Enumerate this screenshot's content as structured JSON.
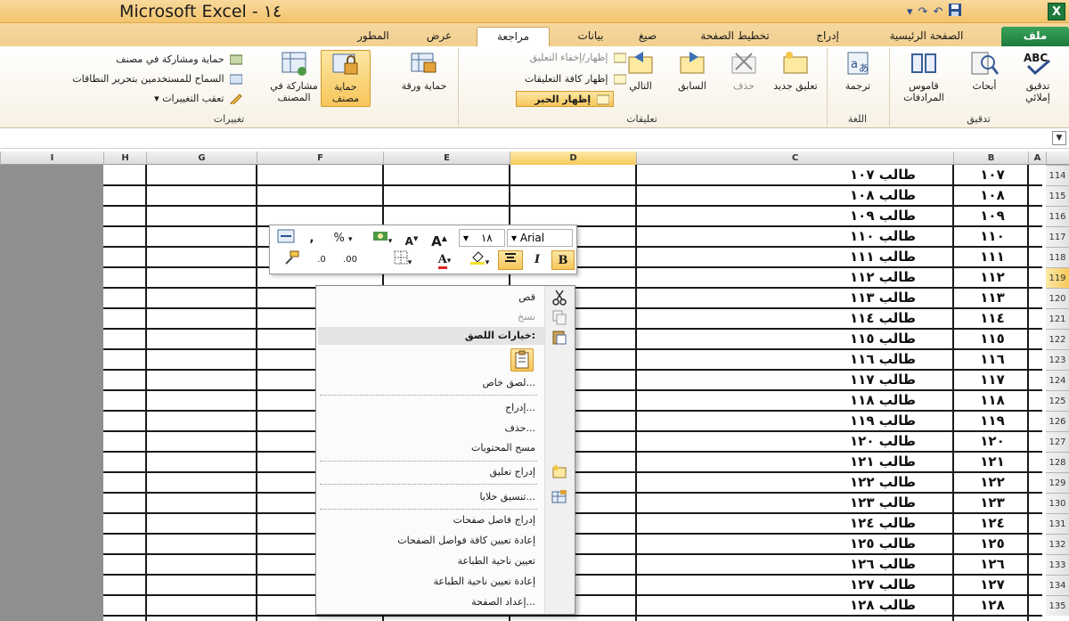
{
  "window": {
    "title": "Microsoft Excel - ١٤",
    "qat_icons": [
      "save-icon",
      "redo-icon",
      "undo-icon",
      "customize-icon"
    ]
  },
  "tabs": {
    "file": "ملف",
    "home": "الصفحة الرئيسية",
    "insert": "إدراج",
    "page_layout": "تخطيط الصفحة",
    "formulas": "صيغ",
    "data": "بيانات",
    "review": "مراجعة",
    "view": "عرض",
    "developer": "المطور"
  },
  "ribbon": {
    "proofing": {
      "label": "تدقيق",
      "spelling": "تدقيق إملائي",
      "research": "أبحاث",
      "thesaurus": "قاموس المرادفات"
    },
    "language": {
      "label": "اللغة",
      "translate": "ترجمة"
    },
    "comments": {
      "label": "تعليقات",
      "new_comment": "تعليق جديد",
      "delete": "حذف",
      "previous": "السابق",
      "next": "التالي",
      "show_hide": "إظهار/إخفاء التعليق",
      "show_all": "إظهار كافة التعليقات",
      "show_ink": "إظهار الحبر"
    },
    "changes": {
      "label": "تغييرات",
      "protect_sheet": "حماية ورقة",
      "protect_workbook": "حماية مصنف",
      "share_workbook": "مشاركة في المصنف",
      "protect_share": "حماية ومشاركة في مصنف",
      "allow_edit_ranges": "السماح للمستخدمين بتحرير النطاقات",
      "track_changes": "تعقب التغييرات"
    }
  },
  "columns": [
    "I",
    "H",
    "G",
    "F",
    "E",
    "D",
    "C",
    "B",
    "A"
  ],
  "selected_column": "D",
  "rows": [
    {
      "num": "114",
      "c": "طالب ١٠٧",
      "b": "١٠٧"
    },
    {
      "num": "115",
      "c": "طالب ١٠٨",
      "b": "١٠٨"
    },
    {
      "num": "116",
      "c": "طالب ١٠٩",
      "b": "١٠٩"
    },
    {
      "num": "117",
      "c": "طالب ١١٠",
      "b": "١١٠"
    },
    {
      "num": "118",
      "c": "طالب ١١١",
      "b": "١١١"
    },
    {
      "num": "119",
      "c": "طالب ١١٢",
      "b": "١١٢"
    },
    {
      "num": "120",
      "c": "طالب ١١٣",
      "b": "١١٣"
    },
    {
      "num": "121",
      "c": "طالب ١١٤",
      "b": "١١٤"
    },
    {
      "num": "122",
      "c": "طالب ١١٥",
      "b": "١١٥"
    },
    {
      "num": "123",
      "c": "طالب ١١٦",
      "b": "١١٦"
    },
    {
      "num": "124",
      "c": "طالب ١١٧",
      "b": "١١٧"
    },
    {
      "num": "125",
      "c": "طالب ١١٨",
      "b": "١١٨"
    },
    {
      "num": "126",
      "c": "طالب ١١٩",
      "b": "١١٩"
    },
    {
      "num": "127",
      "c": "طالب ١٢٠",
      "b": "١٢٠"
    },
    {
      "num": "128",
      "c": "طالب ١٢١",
      "b": "١٢١"
    },
    {
      "num": "129",
      "c": "طالب ١٢٢",
      "b": "١٢٢"
    },
    {
      "num": "130",
      "c": "طالب ١٢٣",
      "b": "١٢٣"
    },
    {
      "num": "131",
      "c": "طالب ١٢٤",
      "b": "١٢٤"
    },
    {
      "num": "132",
      "c": "طالب ١٢٥",
      "b": "١٢٥"
    },
    {
      "num": "133",
      "c": "طالب ١٢٦",
      "b": "١٢٦"
    },
    {
      "num": "134",
      "c": "طالب ١٢٧",
      "b": "١٢٧"
    },
    {
      "num": "135",
      "c": "طالب ١٢٨",
      "b": "١٢٨"
    }
  ],
  "selected_row": "119",
  "mini_toolbar": {
    "font_name": "Arial",
    "font_size": "١٨",
    "percent": "%",
    "comma": ","
  },
  "context_menu": {
    "cut": "قص",
    "copy": "نسخ",
    "paste_options": "خيارات اللصق:",
    "paste_special": "لصق خاص...",
    "insert": "إدراج...",
    "delete": "حذف...",
    "clear_contents": "مسح المحتويات",
    "insert_comment": "إدراج تعليق",
    "format_cells": "تنسيق خلايا...",
    "insert_page_break": "إدراج فاصل صفحات",
    "reset_page_breaks": "إعادة تعيين كافة فواصل الصفحات",
    "set_print_area": "تعيين ناحية الطباعة",
    "reset_print_area": "إعادة تعيين ناحية الطباعة",
    "page_setup": "إعداد الصفحة..."
  }
}
